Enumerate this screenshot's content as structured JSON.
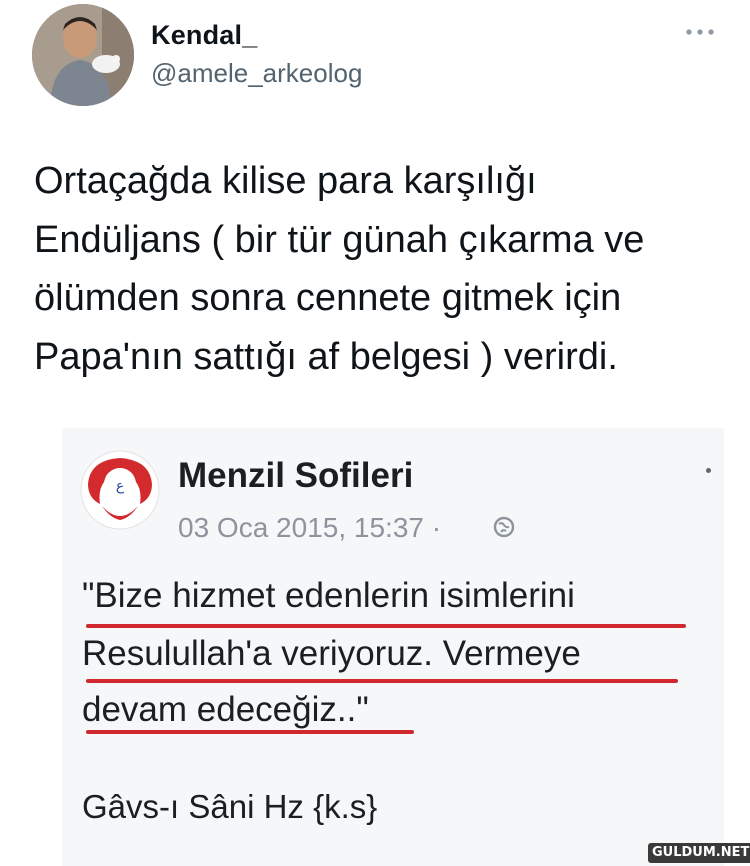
{
  "tweet": {
    "author_name": "Kendal_",
    "author_handle": "@amele_arkeolog",
    "more_icon": "more-horizontal-icon",
    "text": "Ortaçağda kilise para karşılığı\nEndüljans (  bir tür günah çıkarma ve\nölümden sonra cennete gitmek için\nPapa'nın sattığı af belgesi ) verirdi."
  },
  "embedded_post": {
    "page_name": "Menzil Sofileri",
    "date": "03 Oca 2015, 15:37 ·",
    "privacy_icon": "globe-icon",
    "quote_lines": [
      "\"Bize hizmet edenlerin isimlerini",
      "Resulullah'a veriyoruz. Vermeye",
      "devam edeceğiz..\""
    ],
    "signature": "Gâvs-ı Sâni Hz {k.s}",
    "underline_color": "#d0282e"
  },
  "watermark": {
    "text": "GULDUM.NET"
  }
}
